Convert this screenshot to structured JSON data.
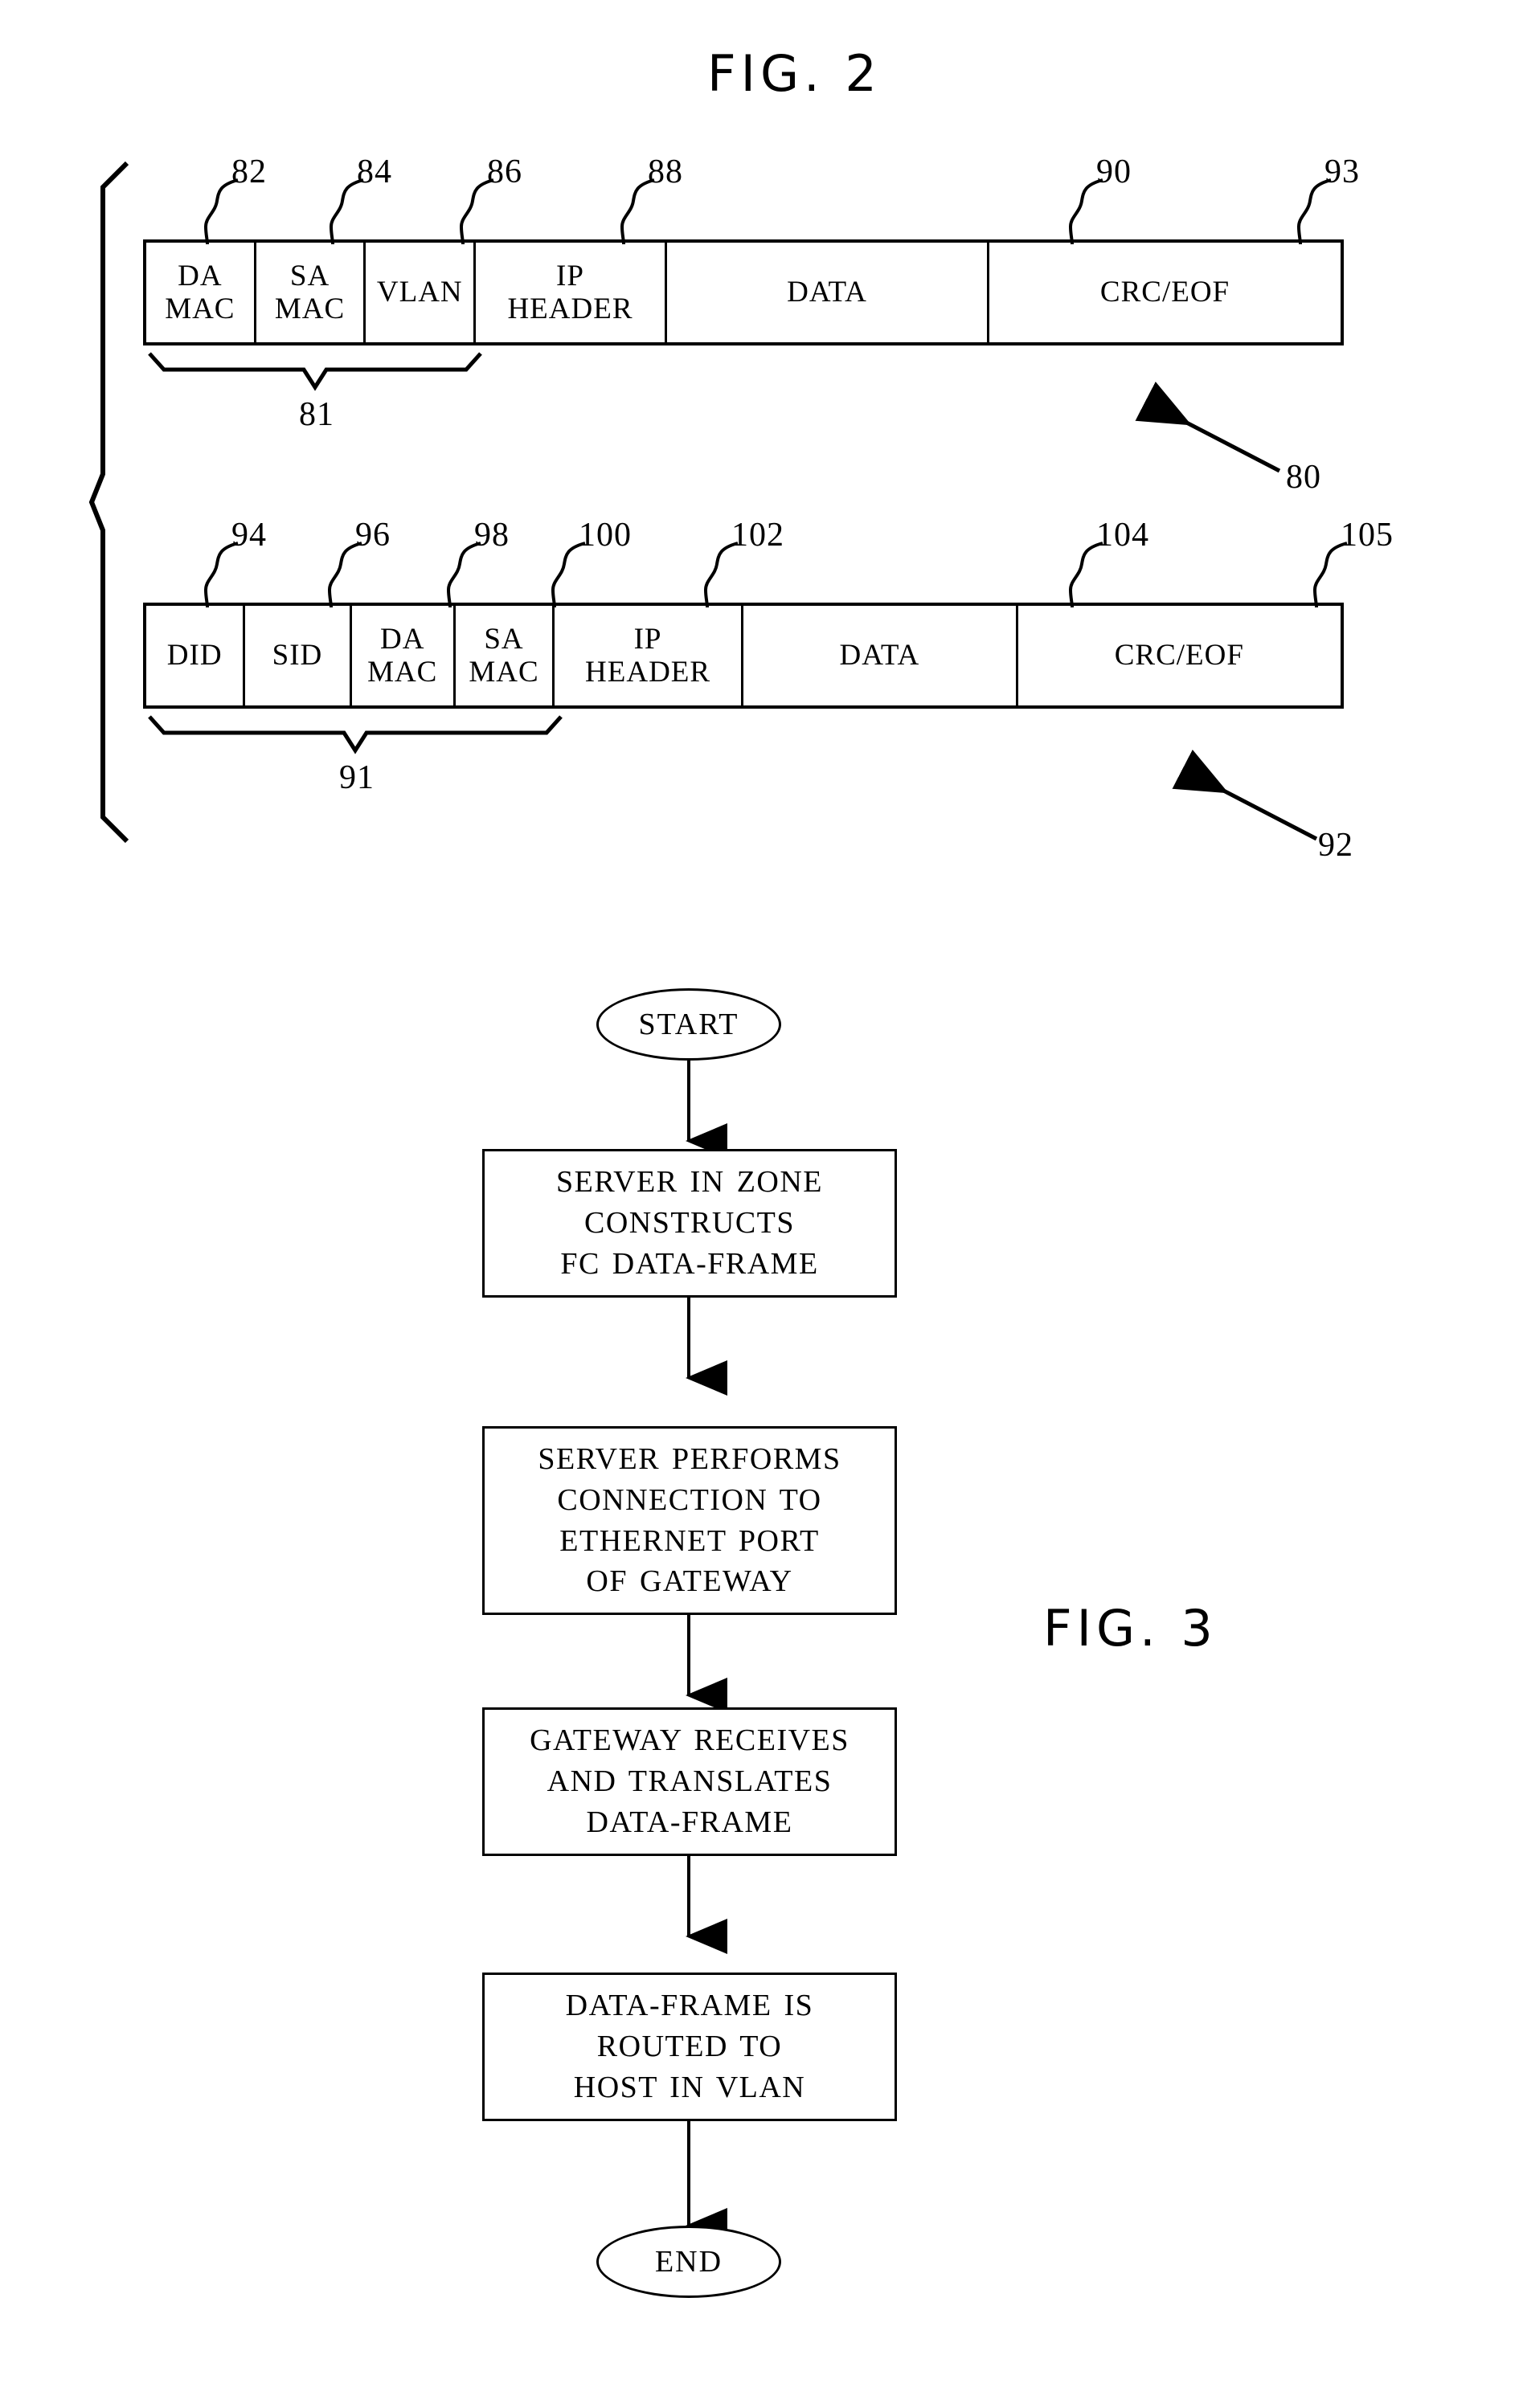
{
  "figures": {
    "fig2": {
      "title": "FIG. 2"
    },
    "fig3": {
      "title": "FIG. 3"
    }
  },
  "fig2": {
    "ethernet_frame": {
      "ref": "80",
      "group_brace_ref": "81",
      "fields": [
        {
          "label": "DA\nMAC",
          "ref": "82"
        },
        {
          "label": "SA\nMAC",
          "ref": "84"
        },
        {
          "label": "VLAN",
          "ref": "86"
        },
        {
          "label": "IP\nHEADER",
          "ref": "88"
        },
        {
          "label": "DATA",
          "ref": "90"
        },
        {
          "label": "CRC/EOF",
          "ref": "93"
        }
      ]
    },
    "fc_frame": {
      "ref": "92",
      "group_brace_ref": "91",
      "fields": [
        {
          "label": "DID",
          "ref": "94"
        },
        {
          "label": "SID",
          "ref": "96"
        },
        {
          "label": "DA\nMAC",
          "ref": "98"
        },
        {
          "label": "SA\nMAC",
          "ref": "100"
        },
        {
          "label": "IP\nHEADER",
          "ref": "102"
        },
        {
          "label": "DATA",
          "ref": "104"
        },
        {
          "label": "CRC/EOF",
          "ref": "105"
        }
      ]
    }
  },
  "fig3": {
    "nodes": [
      {
        "id": "start",
        "type": "terminator",
        "label": "START"
      },
      {
        "id": "step1",
        "type": "process",
        "label": "SERVER IN ZONE\nCONSTRUCTS\nFC DATA-FRAME"
      },
      {
        "id": "step2",
        "type": "process",
        "label": "SERVER PERFORMS\nCONNECTION TO\nETHERNET PORT\nOF GATEWAY"
      },
      {
        "id": "step3",
        "type": "process",
        "label": "GATEWAY RECEIVES\nAND TRANSLATES\nDATA-FRAME"
      },
      {
        "id": "step4",
        "type": "process",
        "label": "DATA-FRAME IS\nROUTED TO\nHOST IN VLAN"
      },
      {
        "id": "end",
        "type": "terminator",
        "label": "END"
      }
    ]
  },
  "colors": {
    "ink": "#000000",
    "paper": "#ffffff"
  }
}
